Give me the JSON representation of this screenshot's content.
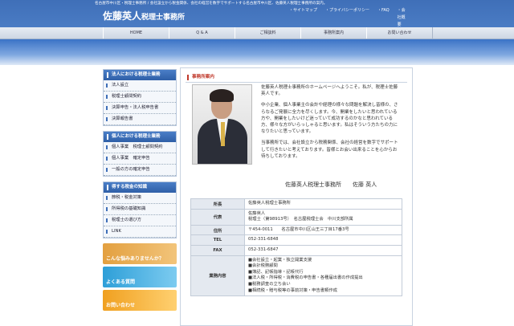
{
  "header": {
    "tagline": "名古屋市中川区・税理士事務所 / 会社設立から税金関係、会社の経営を数字でサポートする名古屋市中川区、佐藤英人税理士事務所の案内。",
    "logo_name": "佐藤英人",
    "logo_suffix": "税理士事務所",
    "links": [
      "サイトマップ",
      "プライバシーポリシー",
      "FAQ",
      "会社概要"
    ]
  },
  "nav": [
    "HOME",
    "Q & A",
    "ご相談料",
    "事務所案内",
    "お問い合わせ"
  ],
  "sidebar": {
    "groups": [
      {
        "title": "法人における税理士業務",
        "items": [
          "法人設立",
          "税理士顧問契約",
          "決算申告・法人税申告書",
          "決算報告書"
        ]
      },
      {
        "title": "個人における税理士業務",
        "items": [
          "個人事業　税理士顧問契約",
          "個人事業　確定申告",
          "一般の方の確定申告"
        ]
      },
      {
        "title": "得する税金の知識",
        "items": [
          "節税・税金対策",
          "所得税の基礎知識",
          "税理士の選び方",
          "LINK"
        ]
      }
    ],
    "banners": [
      "こんな悩みありませんか？",
      "よくある質問",
      "お問い合わせ"
    ]
  },
  "main": {
    "heading": "事務所案内",
    "intro": [
      "佐藤英人税理士事務所のホームページへようこそ。私が、税理士佐藤英人です。",
      "中小企業、個人事業主の会計や経理の様々な問題を解決し皆様の、さらなるご発展に全力を尽くします。今、開業をしたいと思われている方や、開業をしたいけど迷っていて成功するのかなと思われている方、様々な方がいらっしゃると思います。私はそういう方たちの力になりたいと思っています。",
      "当事務所では、会社設立から税務関係、会社の経営を数字でサポートして行きたいと考えております。皆様とお会い出来ることを心からお待ちしております。"
    ],
    "signature": "佐藤英人税理士事務所　　佐藤 英人",
    "table": [
      {
        "label": "所長",
        "value": [
          "佐藤英人税理士事務所"
        ]
      },
      {
        "label": "代表",
        "value": [
          "佐藤英人",
          "税理士（第98913号）　名古屋税理士会　中川支部所属"
        ]
      },
      {
        "label": "住所",
        "value": [
          "〒454-0011　　名古屋市中川区山王三丁目17番3号"
        ]
      },
      {
        "label": "TEL",
        "value": [
          "052-331-6848"
        ]
      },
      {
        "label": "FAX",
        "value": [
          "052-331-6847"
        ]
      },
      {
        "label": "業務内容",
        "value": [
          "■会社設立・起業・独立開業支援",
          "■会計税務顧問",
          "■簿記、記帳指導・記帳代行",
          "■法人税・所得税・消費税の申告書・各種届出書の作成提出",
          "■税務調査の立ち会い",
          "■相続税・贈与税等の事前対策・申告書類作成"
        ]
      }
    ]
  }
}
